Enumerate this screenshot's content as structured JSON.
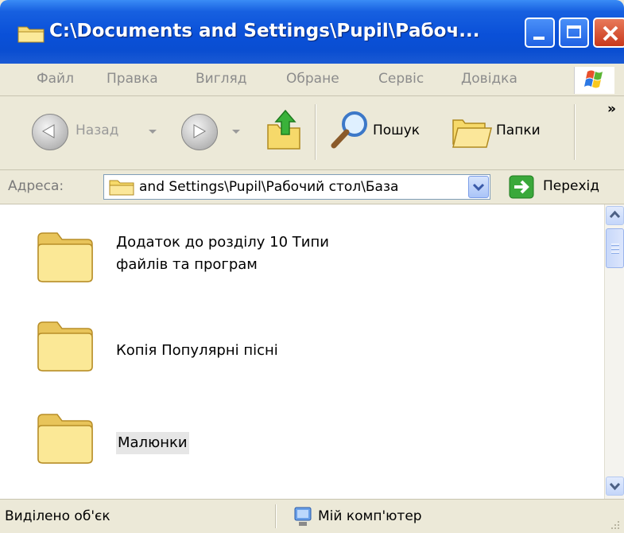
{
  "window": {
    "title": "C:\\Documents and Settings\\Pupil\\Рабоч...",
    "controls": {
      "minimize": "minimize-button",
      "maximize": "maximize-button",
      "close": "close-button"
    }
  },
  "menu": {
    "items": [
      "Файл",
      "Правка",
      "Вигляд",
      "Обране",
      "Сервіс",
      "Довідка"
    ]
  },
  "toolbar": {
    "back_label": "Назад",
    "search_label": "Пошук",
    "folders_label": "Папки",
    "overflow": "»",
    "icons": [
      "back-arrow-icon",
      "forward-arrow-icon",
      "folder-up-icon",
      "search-icon",
      "folders-icon"
    ]
  },
  "address": {
    "label": "Адреса:",
    "value": "and Settings\\Pupil\\Рабочий стол\\База",
    "go_label": "Перехід"
  },
  "items": [
    {
      "line1": "Додаток до розділу 10 Типи",
      "line2": "файлів та програм"
    },
    {
      "line1": "Копія Популярні пісні",
      "line2": ""
    },
    {
      "line1": "Малюнки",
      "line2": ""
    }
  ],
  "status": {
    "selection_text": "Виділено об'єк",
    "location_text": "Мій комп'ютер"
  },
  "colors": {
    "titlebar": "#0a50d8",
    "folder": "#f2d76c",
    "chrome": "#ece9d8",
    "go_green": "#3aa83a"
  }
}
